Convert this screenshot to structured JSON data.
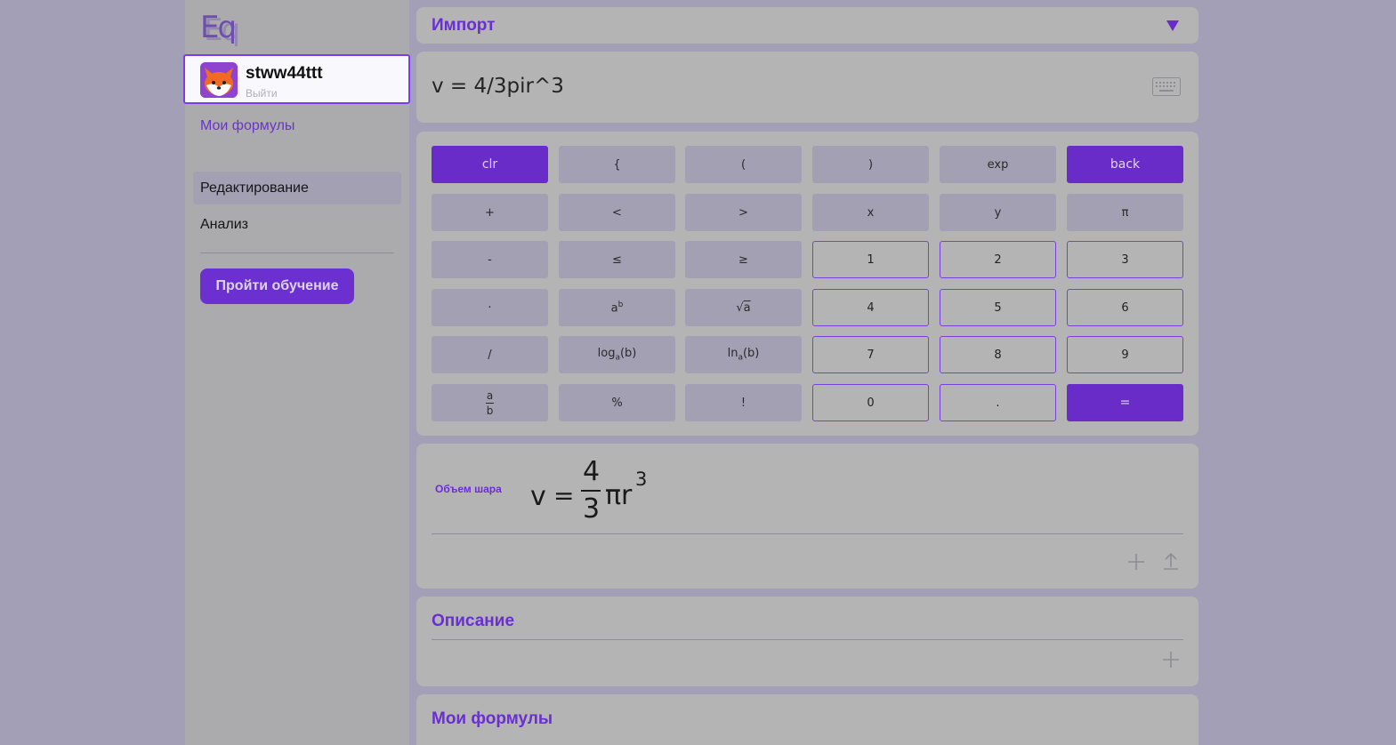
{
  "sidebar": {
    "logo_text": "Eq",
    "user": {
      "name": "stww44ttt",
      "logout": "Выйти"
    },
    "my_formulas": "Мои формулы",
    "nav": [
      "Редактирование",
      "Анализ"
    ],
    "tutorial_button": "Пройти обучение"
  },
  "import_panel": {
    "title": "Импорт"
  },
  "input": {
    "value": "v = 4/3pir^3"
  },
  "keypad": {
    "rows": [
      [
        "clr",
        "{",
        "(",
        ")",
        "exp",
        "back"
      ],
      [
        "+",
        "<",
        ">",
        "x",
        "y",
        "π"
      ],
      [
        "-",
        "≤",
        "≥",
        "1",
        "2",
        "3"
      ],
      [
        "·",
        "ab",
        "√a",
        "4",
        "5",
        "6"
      ],
      [
        "/",
        "loga(b)",
        "lna(b)",
        "7",
        "8",
        "9"
      ],
      [
        "a/b",
        "%",
        "!",
        "0",
        ".",
        "="
      ]
    ]
  },
  "result": {
    "label": "Объем шара",
    "lhs": "v",
    "equals": "=",
    "numerator": "4",
    "denominator": "3",
    "tail": "πr",
    "exponent": "3"
  },
  "description": {
    "title": "Описание"
  },
  "my_formulas_panel": {
    "title": "Мои формулы"
  },
  "colors": {
    "accent": "#6a2cc9",
    "background": "#a39fb6",
    "panel": "#b4b4b4"
  }
}
